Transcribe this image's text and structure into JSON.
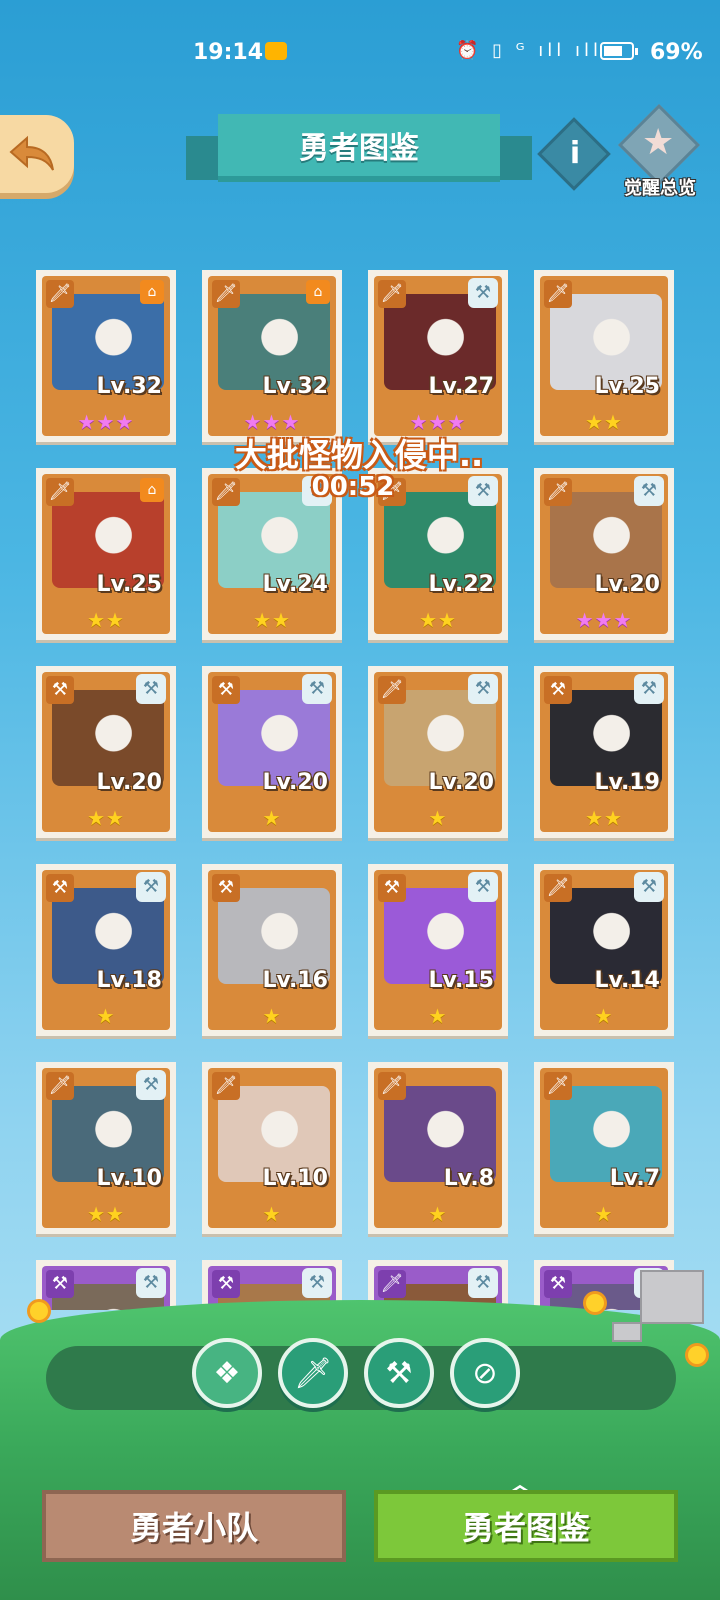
{
  "status_bar": {
    "time": "19:14",
    "icons": "⏰ ▯ ᴳ ıll ıll",
    "battery_level": 0.69,
    "battery_text": "69%"
  },
  "header": {
    "title": "勇者图鉴",
    "awaken_label": "觉醒总览"
  },
  "event": {
    "text": "大批怪物入侵中..",
    "timer": "00:52"
  },
  "heroes": [
    {
      "level": "Lv.32",
      "stars": "★★★",
      "star_color": "pink",
      "class": "sword",
      "badge": "awake",
      "bg": "#3b6ea8"
    },
    {
      "level": "Lv.32",
      "stars": "★★★",
      "star_color": "pink",
      "class": "sword",
      "badge": "awake",
      "bg": "#4a7f7a"
    },
    {
      "level": "Lv.27",
      "stars": "★★★",
      "star_color": "pink",
      "class": "sword",
      "badge": "hammer",
      "bg": "#6b2a2a"
    },
    {
      "level": "Lv.25",
      "stars": "★★",
      "star_color": "gold",
      "class": "sword",
      "badge": "none",
      "bg": "#d8d8dc"
    },
    {
      "level": "Lv.25",
      "stars": "★★",
      "star_color": "gold",
      "class": "sword",
      "badge": "awake",
      "bg": "#b8402c"
    },
    {
      "level": "Lv.24",
      "stars": "★★",
      "star_color": "gold",
      "class": "sword",
      "badge": "hammer",
      "bg": "#8ccfc6"
    },
    {
      "level": "Lv.22",
      "stars": "★★",
      "star_color": "gold",
      "class": "sword",
      "badge": "hammer",
      "bg": "#2f8a6a"
    },
    {
      "level": "Lv.20",
      "stars": "★★★",
      "star_color": "pink",
      "class": "sword",
      "badge": "hammer",
      "bg": "#a9744a"
    },
    {
      "level": "Lv.20",
      "stars": "★★",
      "star_color": "gold",
      "class": "hammer",
      "badge": "hammer",
      "bg": "#7a4a2a"
    },
    {
      "level": "Lv.20",
      "stars": "★",
      "star_color": "gold",
      "class": "hammer",
      "badge": "hammer",
      "bg": "#9a7ad8"
    },
    {
      "level": "Lv.20",
      "stars": "★",
      "star_color": "gold",
      "class": "sword",
      "badge": "hammer",
      "bg": "#c8a470"
    },
    {
      "level": "Lv.19",
      "stars": "★★",
      "star_color": "gold",
      "class": "hammer",
      "badge": "hammer",
      "bg": "#2b2b30"
    },
    {
      "level": "Lv.18",
      "stars": "★",
      "star_color": "gold",
      "class": "hammer",
      "badge": "hammer",
      "bg": "#3d5a8a"
    },
    {
      "level": "Lv.16",
      "stars": "★",
      "star_color": "gold",
      "class": "hammer",
      "badge": "none",
      "bg": "#b8b8bc"
    },
    {
      "level": "Lv.15",
      "stars": "★",
      "star_color": "gold",
      "class": "hammer",
      "badge": "hammer",
      "bg": "#9b5ad8"
    },
    {
      "level": "Lv.14",
      "stars": "★",
      "star_color": "gold",
      "class": "sword",
      "badge": "hammer",
      "bg": "#2a2a34"
    },
    {
      "level": "Lv.10",
      "stars": "★★",
      "star_color": "gold",
      "class": "sword",
      "badge": "hammer",
      "bg": "#4a6a7a"
    },
    {
      "level": "Lv.10",
      "stars": "★",
      "star_color": "gold",
      "class": "sword",
      "badge": "none",
      "bg": "#e0c8b8"
    },
    {
      "level": "Lv.8",
      "stars": "★",
      "star_color": "gold",
      "class": "sword",
      "badge": "none",
      "bg": "#6a4a8a"
    },
    {
      "level": "Lv.7",
      "stars": "★",
      "star_color": "gold",
      "class": "sword",
      "badge": "none",
      "bg": "#4aa8b8"
    },
    {
      "level": "",
      "stars": "",
      "star_color": "gold",
      "class": "hammer",
      "badge": "hammer",
      "bg": "#7a6a5a",
      "rarity": "purple"
    },
    {
      "level": "",
      "stars": "",
      "star_color": "gold",
      "class": "hammer",
      "badge": "hammer",
      "bg": "#a8784a",
      "rarity": "purple"
    },
    {
      "level": "",
      "stars": "",
      "star_color": "gold",
      "class": "sword",
      "badge": "hammer",
      "bg": "#8a5a3a",
      "rarity": "purple"
    },
    {
      "level": "",
      "stars": "",
      "star_color": "gold",
      "class": "hammer",
      "badge": "hammer",
      "bg": "#6a5a8a",
      "rarity": "purple"
    }
  ],
  "filters": [
    {
      "name": "all-filter-icon",
      "glyph": "❖"
    },
    {
      "name": "sword-filter-icon",
      "glyph": "🗡"
    },
    {
      "name": "hammer-filter-icon",
      "glyph": "⚒"
    },
    {
      "name": "compass-filter-icon",
      "glyph": "⊘"
    }
  ],
  "bottom_tabs": {
    "team": "勇者小队",
    "codex": "勇者图鉴"
  }
}
